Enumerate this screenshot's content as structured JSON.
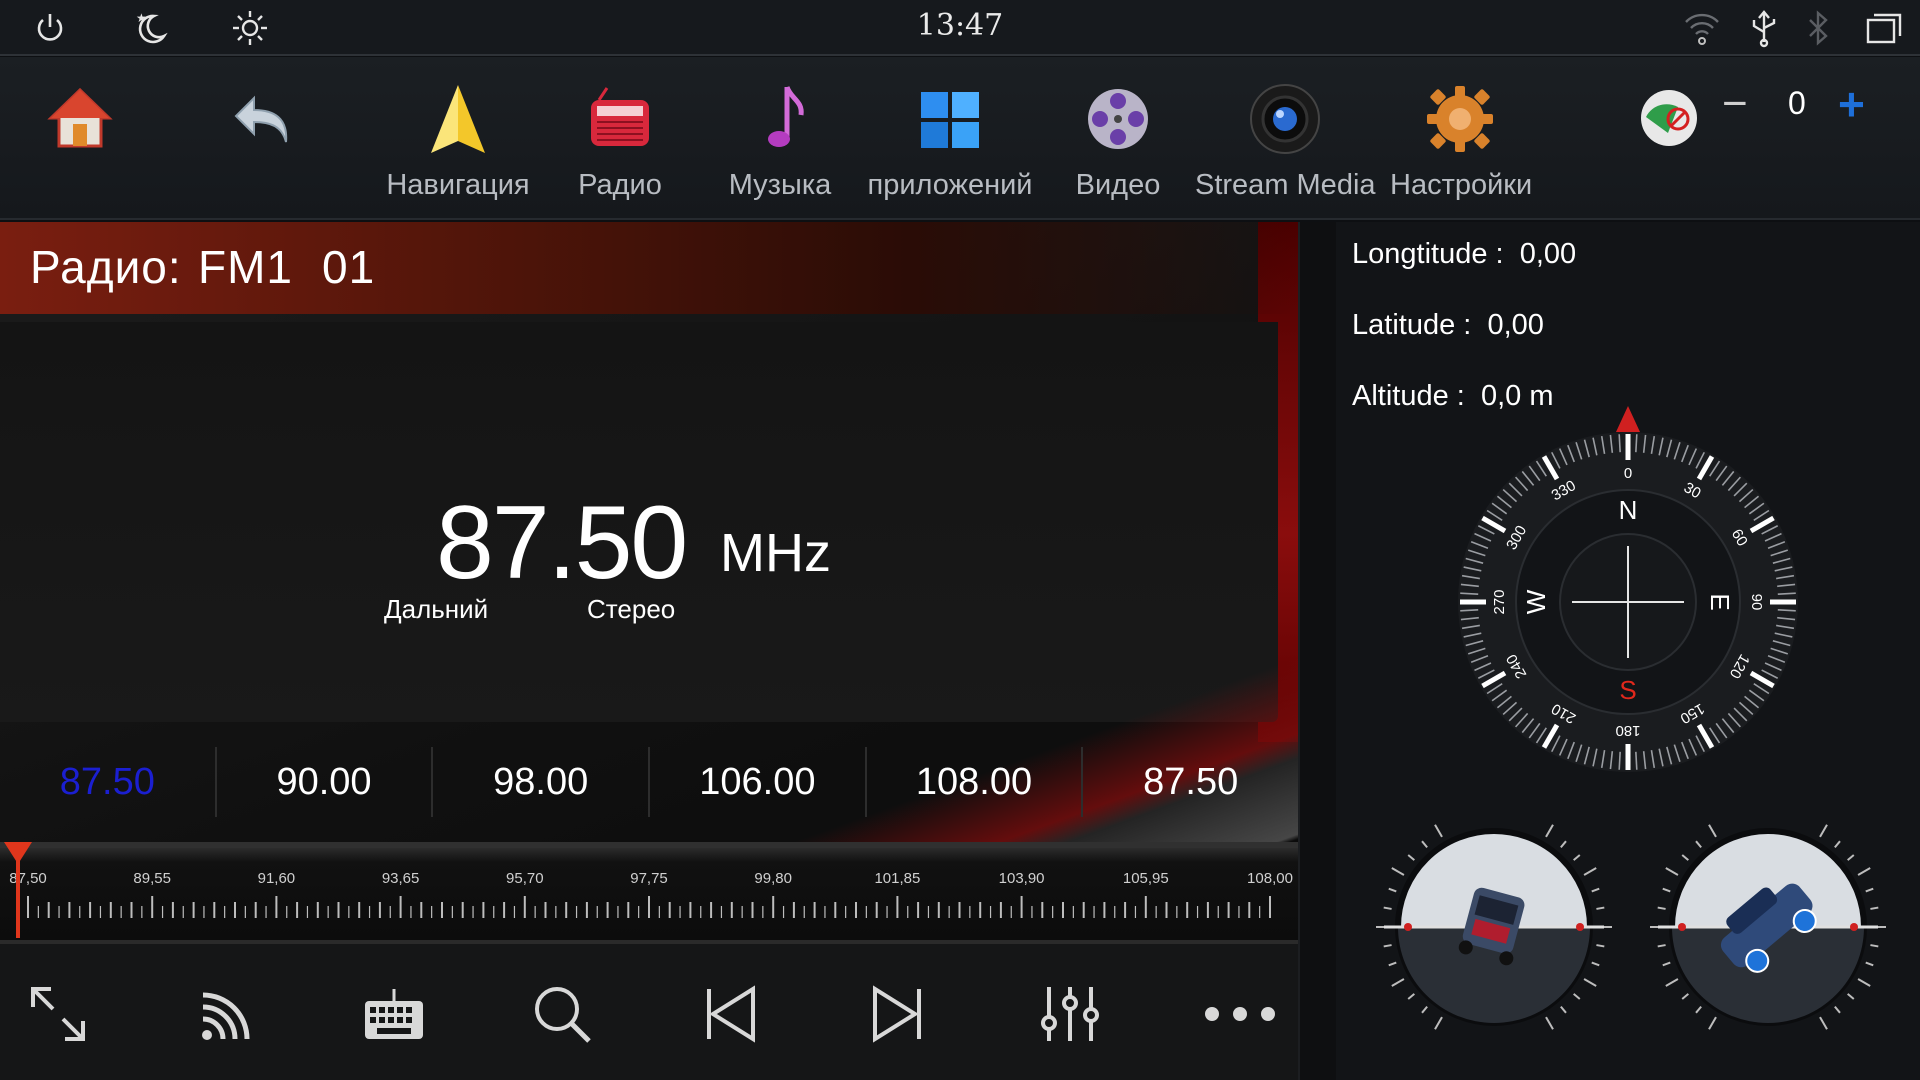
{
  "statusbar": {
    "time": "13:47",
    "icons": [
      "power-icon",
      "night-mode-icon",
      "brightness-icon",
      "wifi-icon",
      "usb-icon",
      "bluetooth-icon",
      "recent-apps-icon"
    ]
  },
  "launcher": {
    "apps": [
      {
        "icon": "home-icon",
        "label": ""
      },
      {
        "icon": "back-icon",
        "label": ""
      },
      {
        "icon": "navigation-icon",
        "label": "Навигация"
      },
      {
        "icon": "radio-icon",
        "label": "Радио"
      },
      {
        "icon": "music-icon",
        "label": "Музыка"
      },
      {
        "icon": "apps-icon",
        "label": "приложений"
      },
      {
        "icon": "video-icon",
        "label": "Видео"
      },
      {
        "icon": "stream-media-icon",
        "label": "Stream Media"
      },
      {
        "icon": "settings-icon",
        "label": "Настройки"
      }
    ],
    "volume": {
      "minus": "−",
      "value": "0",
      "plus": "+"
    }
  },
  "radio": {
    "title": "Радио:",
    "band": "FM1",
    "preset_number": "01",
    "frequency": "87.50",
    "unit": "MHz",
    "mode_left": "Дальний",
    "mode_right": "Стерео",
    "presets": [
      "87.50",
      "90.00",
      "98.00",
      "106.00",
      "108.00",
      "87.50"
    ],
    "active_preset_index": 0,
    "scale_labels": [
      "87,50",
      "89,55",
      "91,60",
      "93,65",
      "95,70",
      "97,75",
      "99,80",
      "101,85",
      "103,90",
      "105,95",
      "108,00"
    ],
    "page_dots": 3,
    "active_page": 0
  },
  "controls": [
    "fullscreen-icon",
    "radio-signal-icon",
    "keyboard-icon",
    "search-icon",
    "previous-icon",
    "next-icon",
    "equalizer-icon",
    "more-icon"
  ],
  "gps": {
    "longitude_label": "Longtitude :",
    "longitude_value": "0,00",
    "latitude_label": "Latitude :",
    "latitude_value": "0,00",
    "altitude_label": "Altitude :",
    "altitude_value": "0,0 m",
    "compass": {
      "north": "N",
      "south": "S",
      "east": "E",
      "west": "W",
      "degrees": [
        "0",
        "30",
        "60",
        "90",
        "120",
        "150",
        "180",
        "210",
        "240",
        "270",
        "300",
        "330"
      ]
    }
  },
  "colors": {
    "accent_red": "#e0281c",
    "preset_active": "#1b1fd1",
    "volume_plus": "#1e6fd9"
  }
}
